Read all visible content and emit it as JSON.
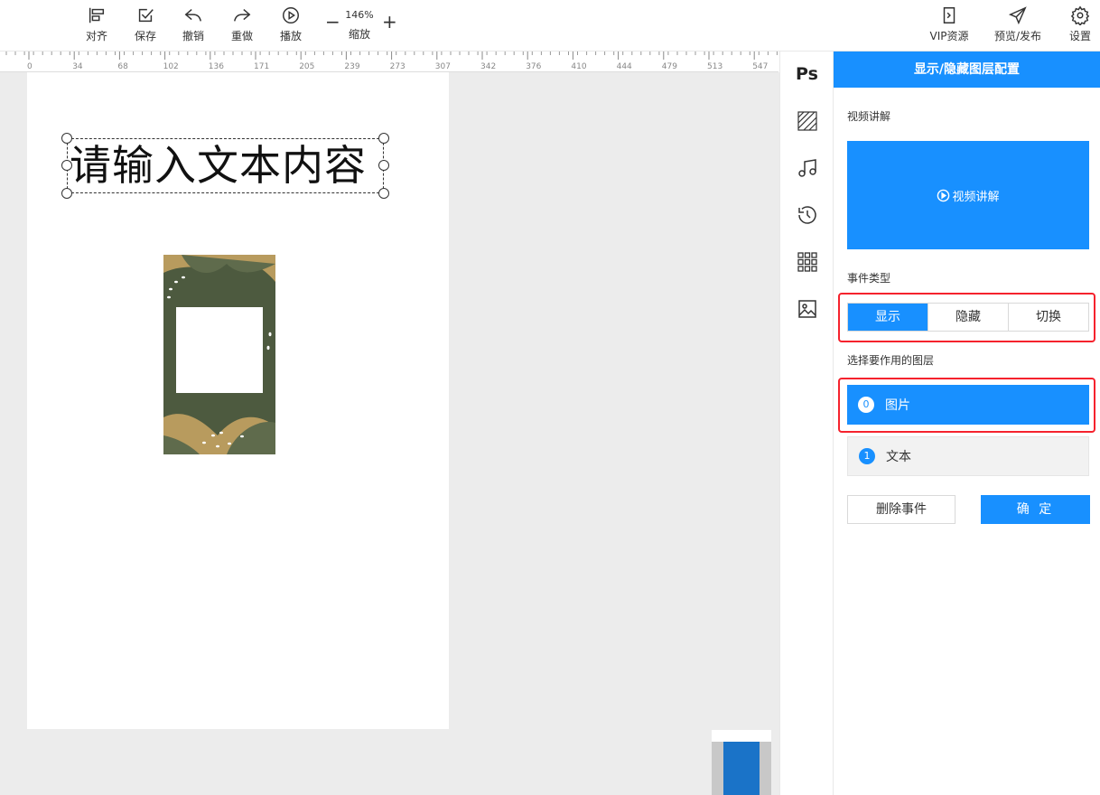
{
  "toolbar": {
    "align": "对齐",
    "save": "保存",
    "undo": "撤销",
    "redo": "重做",
    "play": "播放",
    "zoom_value": "146%",
    "zoom_label": "缩放",
    "zoom_out": "−",
    "zoom_in": "+",
    "vip": "VIP资源",
    "preview": "预览/发布",
    "settings": "设置"
  },
  "ruler": {
    "ticks": [
      "0",
      "34",
      "68",
      "102",
      "136",
      "171",
      "205",
      "239",
      "273",
      "307",
      "342",
      "376",
      "410",
      "444",
      "479",
      "513",
      "547"
    ]
  },
  "canvas": {
    "text_content": "请输入文本内容"
  },
  "icon_strip": {
    "ps": "Ps",
    "icons": [
      "texture-icon",
      "music-icon",
      "history-icon",
      "grid-icon",
      "image-icon"
    ]
  },
  "panel": {
    "title": "显示/隐藏图层配置",
    "video_section": "视频讲解",
    "video_button": "视频讲解",
    "event_type_title": "事件类型",
    "event_types": [
      "显示",
      "隐藏",
      "切换"
    ],
    "active_event": "显示",
    "layer_section": "选择要作用的图层",
    "layers": [
      {
        "index": "0",
        "name": "图片",
        "selected": true
      },
      {
        "index": "1",
        "name": "文本",
        "selected": false
      }
    ],
    "delete_button": "删除事件",
    "confirm_button": "确 定"
  },
  "colors": {
    "primary": "#1890ff",
    "highlight": "#f5222d"
  }
}
